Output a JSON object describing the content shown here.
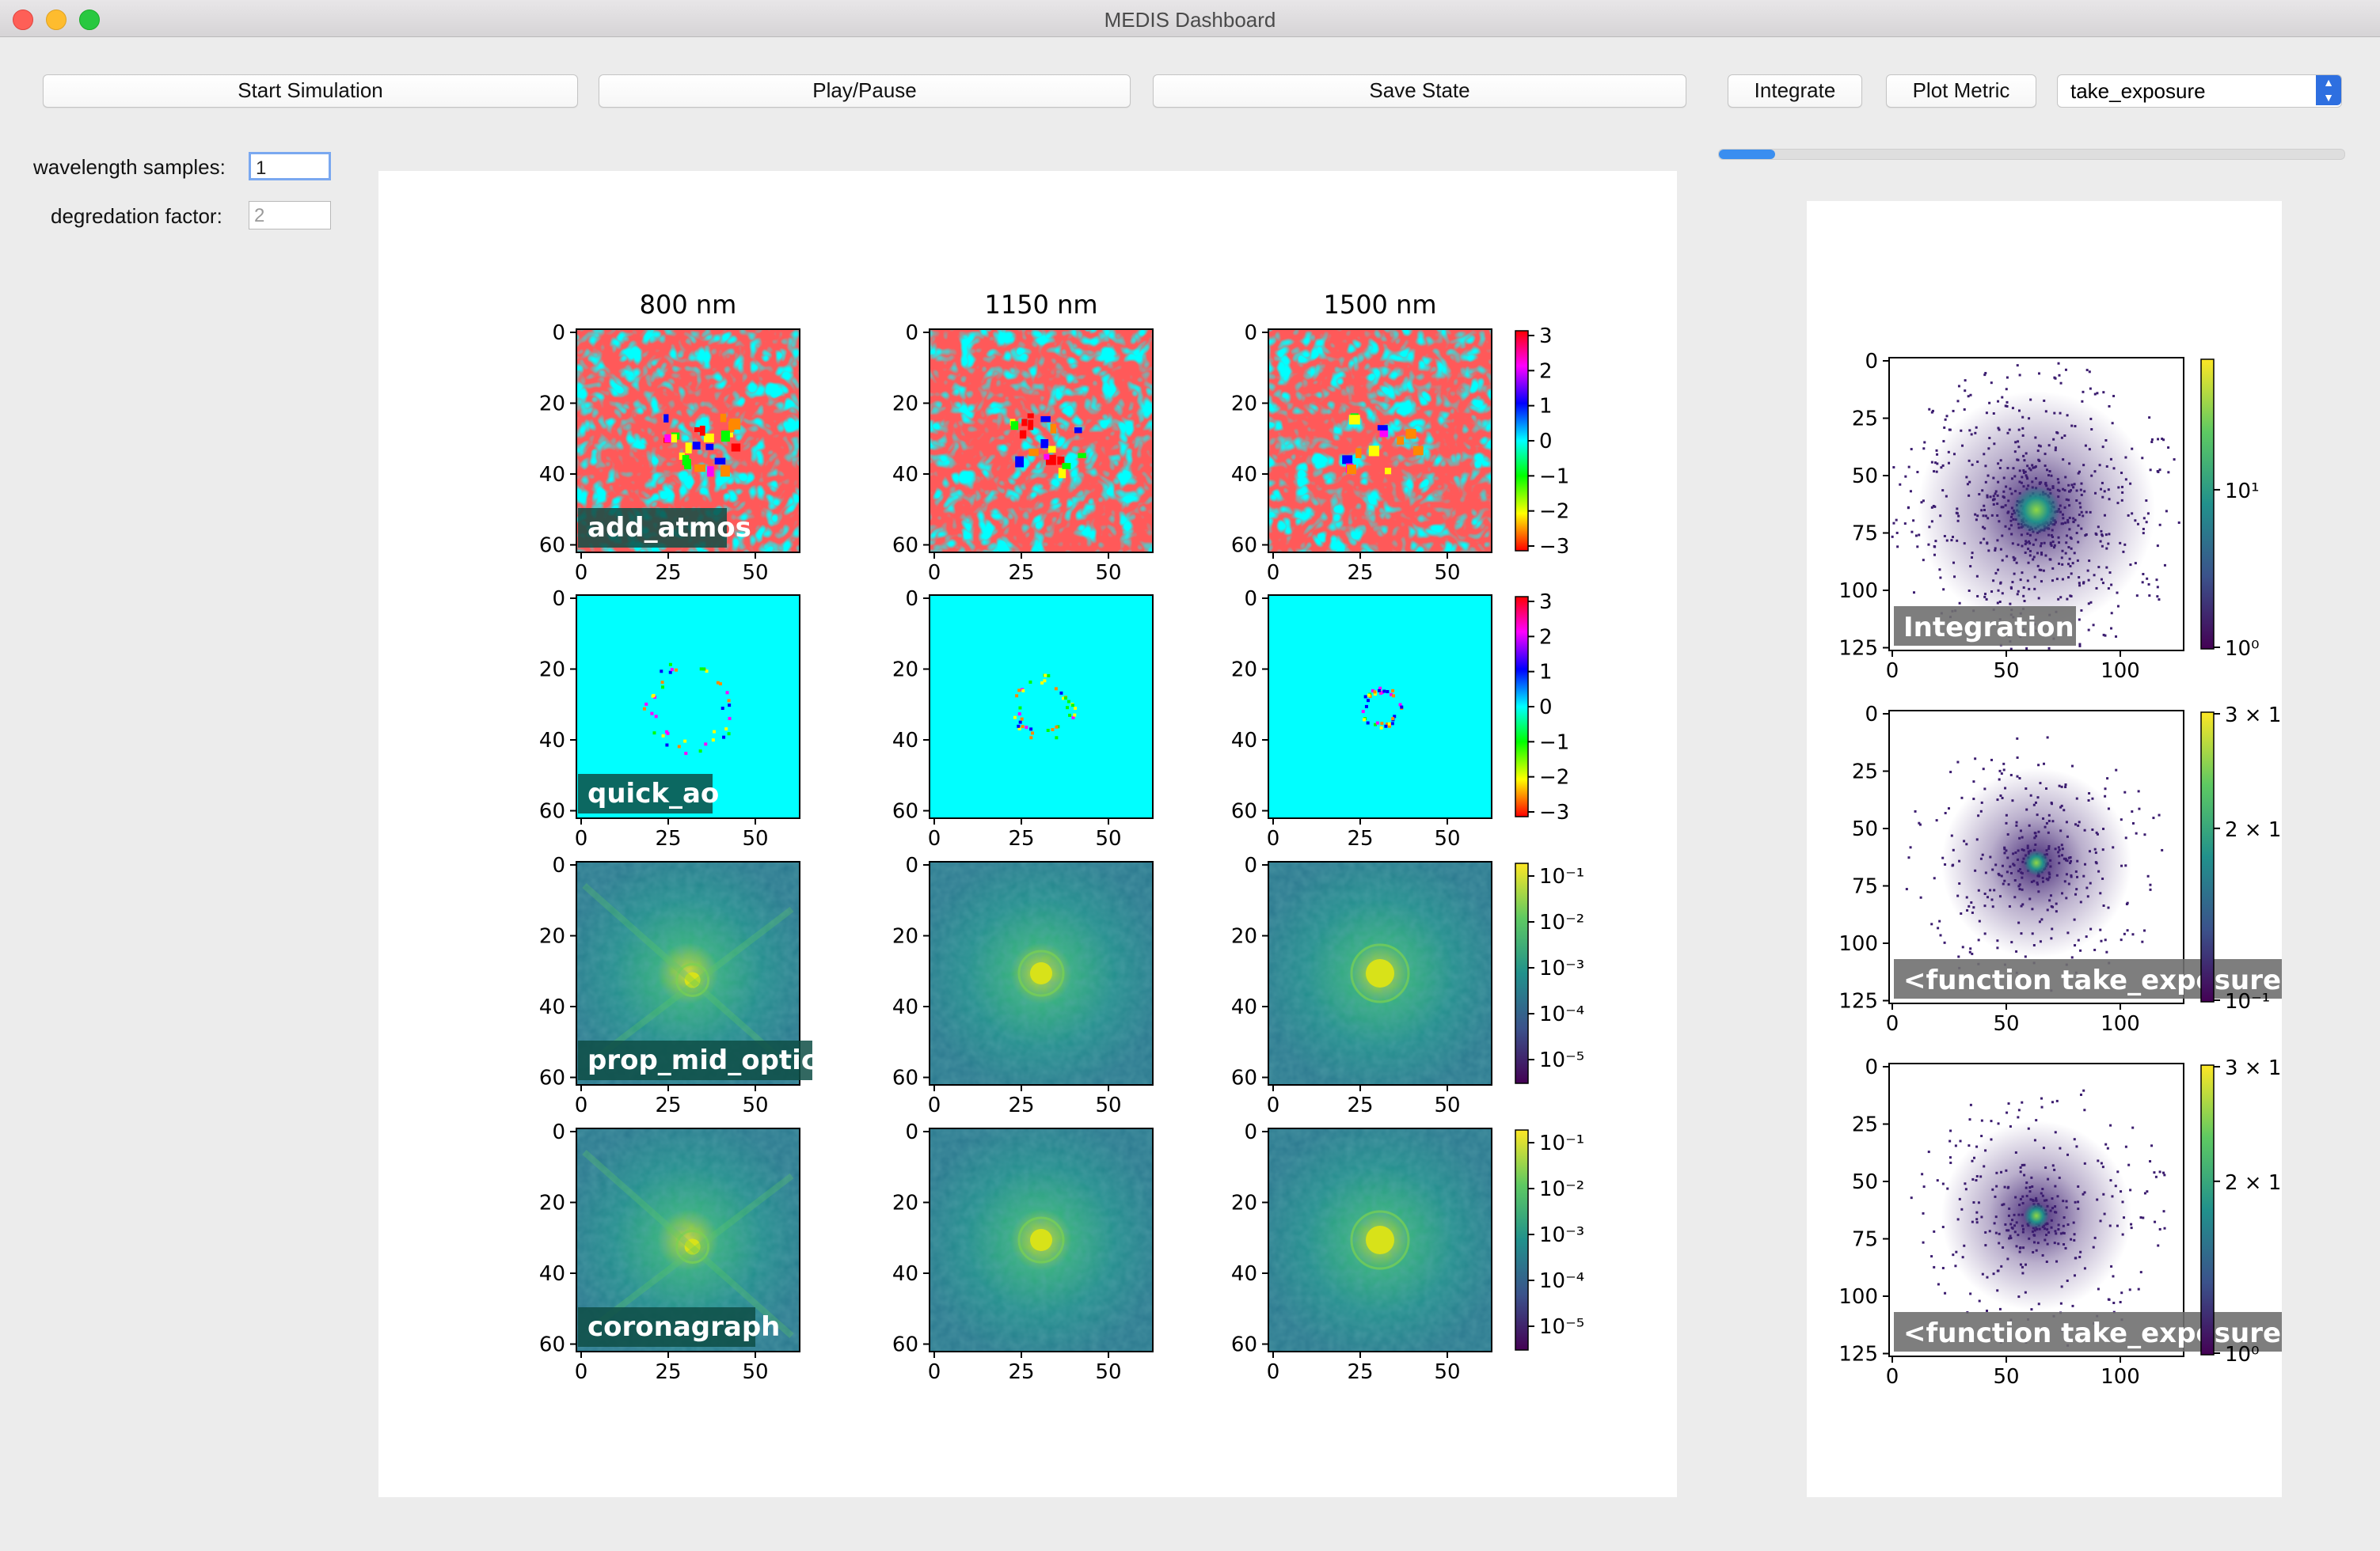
{
  "window": {
    "title": "MEDIS Dashboard"
  },
  "toolbar": {
    "start_label": "Start Simulation",
    "play_label": "Play/Pause",
    "save_label": "Save State",
    "integrate_label": "Integrate",
    "plot_metric_label": "Plot Metric",
    "metric_select_value": "take_exposure"
  },
  "params": {
    "wavelength_label": "wavelength samples:",
    "wavelength_value": "1",
    "degradation_label": "degredation factor:",
    "degradation_placeholder": "2"
  },
  "progress": {
    "fraction": 0.09
  },
  "colors": {
    "accent": "#2e6fe0",
    "progress": "#3a8ef0",
    "phase_background": "#00ffff",
    "phase_patches": "#ff1a1a",
    "label_box": "#0e4d45",
    "label_box_gray": "#707070"
  },
  "main_figure": {
    "column_titles": [
      "800 nm",
      "1150 nm",
      "1500 nm"
    ],
    "row_labels": [
      "add_atmos",
      "quick_ao",
      "prop_mid_optics",
      "coronagraph"
    ],
    "y_ticks": [
      "0",
      "20",
      "40",
      "60"
    ],
    "x_ticks": [
      "0",
      "25",
      "50"
    ],
    "phase_colorbar_ticks": [
      "3",
      "2",
      "1",
      "0",
      "−1",
      "−2",
      "−3"
    ],
    "log_colorbar_ticks": [
      "10⁻¹",
      "10⁻²",
      "10⁻³",
      "10⁻⁴",
      "10⁻⁵"
    ],
    "row_colormaps": [
      "phase (hsv)",
      "phase (hsv)",
      "intensity log (viridis)",
      "intensity log (viridis)"
    ]
  },
  "side_figure": {
    "panel_labels": [
      "Integration",
      "<function take_exposure a",
      "<function take_exposure a"
    ],
    "y_ticks": [
      "0",
      "25",
      "50",
      "75",
      "100",
      "125"
    ],
    "x_ticks": [
      "0",
      "50",
      "100"
    ],
    "colorbar_ticks": [
      [
        "10¹",
        "10⁰"
      ],
      [
        "3 × 1",
        "2 × 1",
        "10⁻¹"
      ],
      [
        "3 × 1",
        "2 × 1",
        "10⁰"
      ]
    ]
  }
}
